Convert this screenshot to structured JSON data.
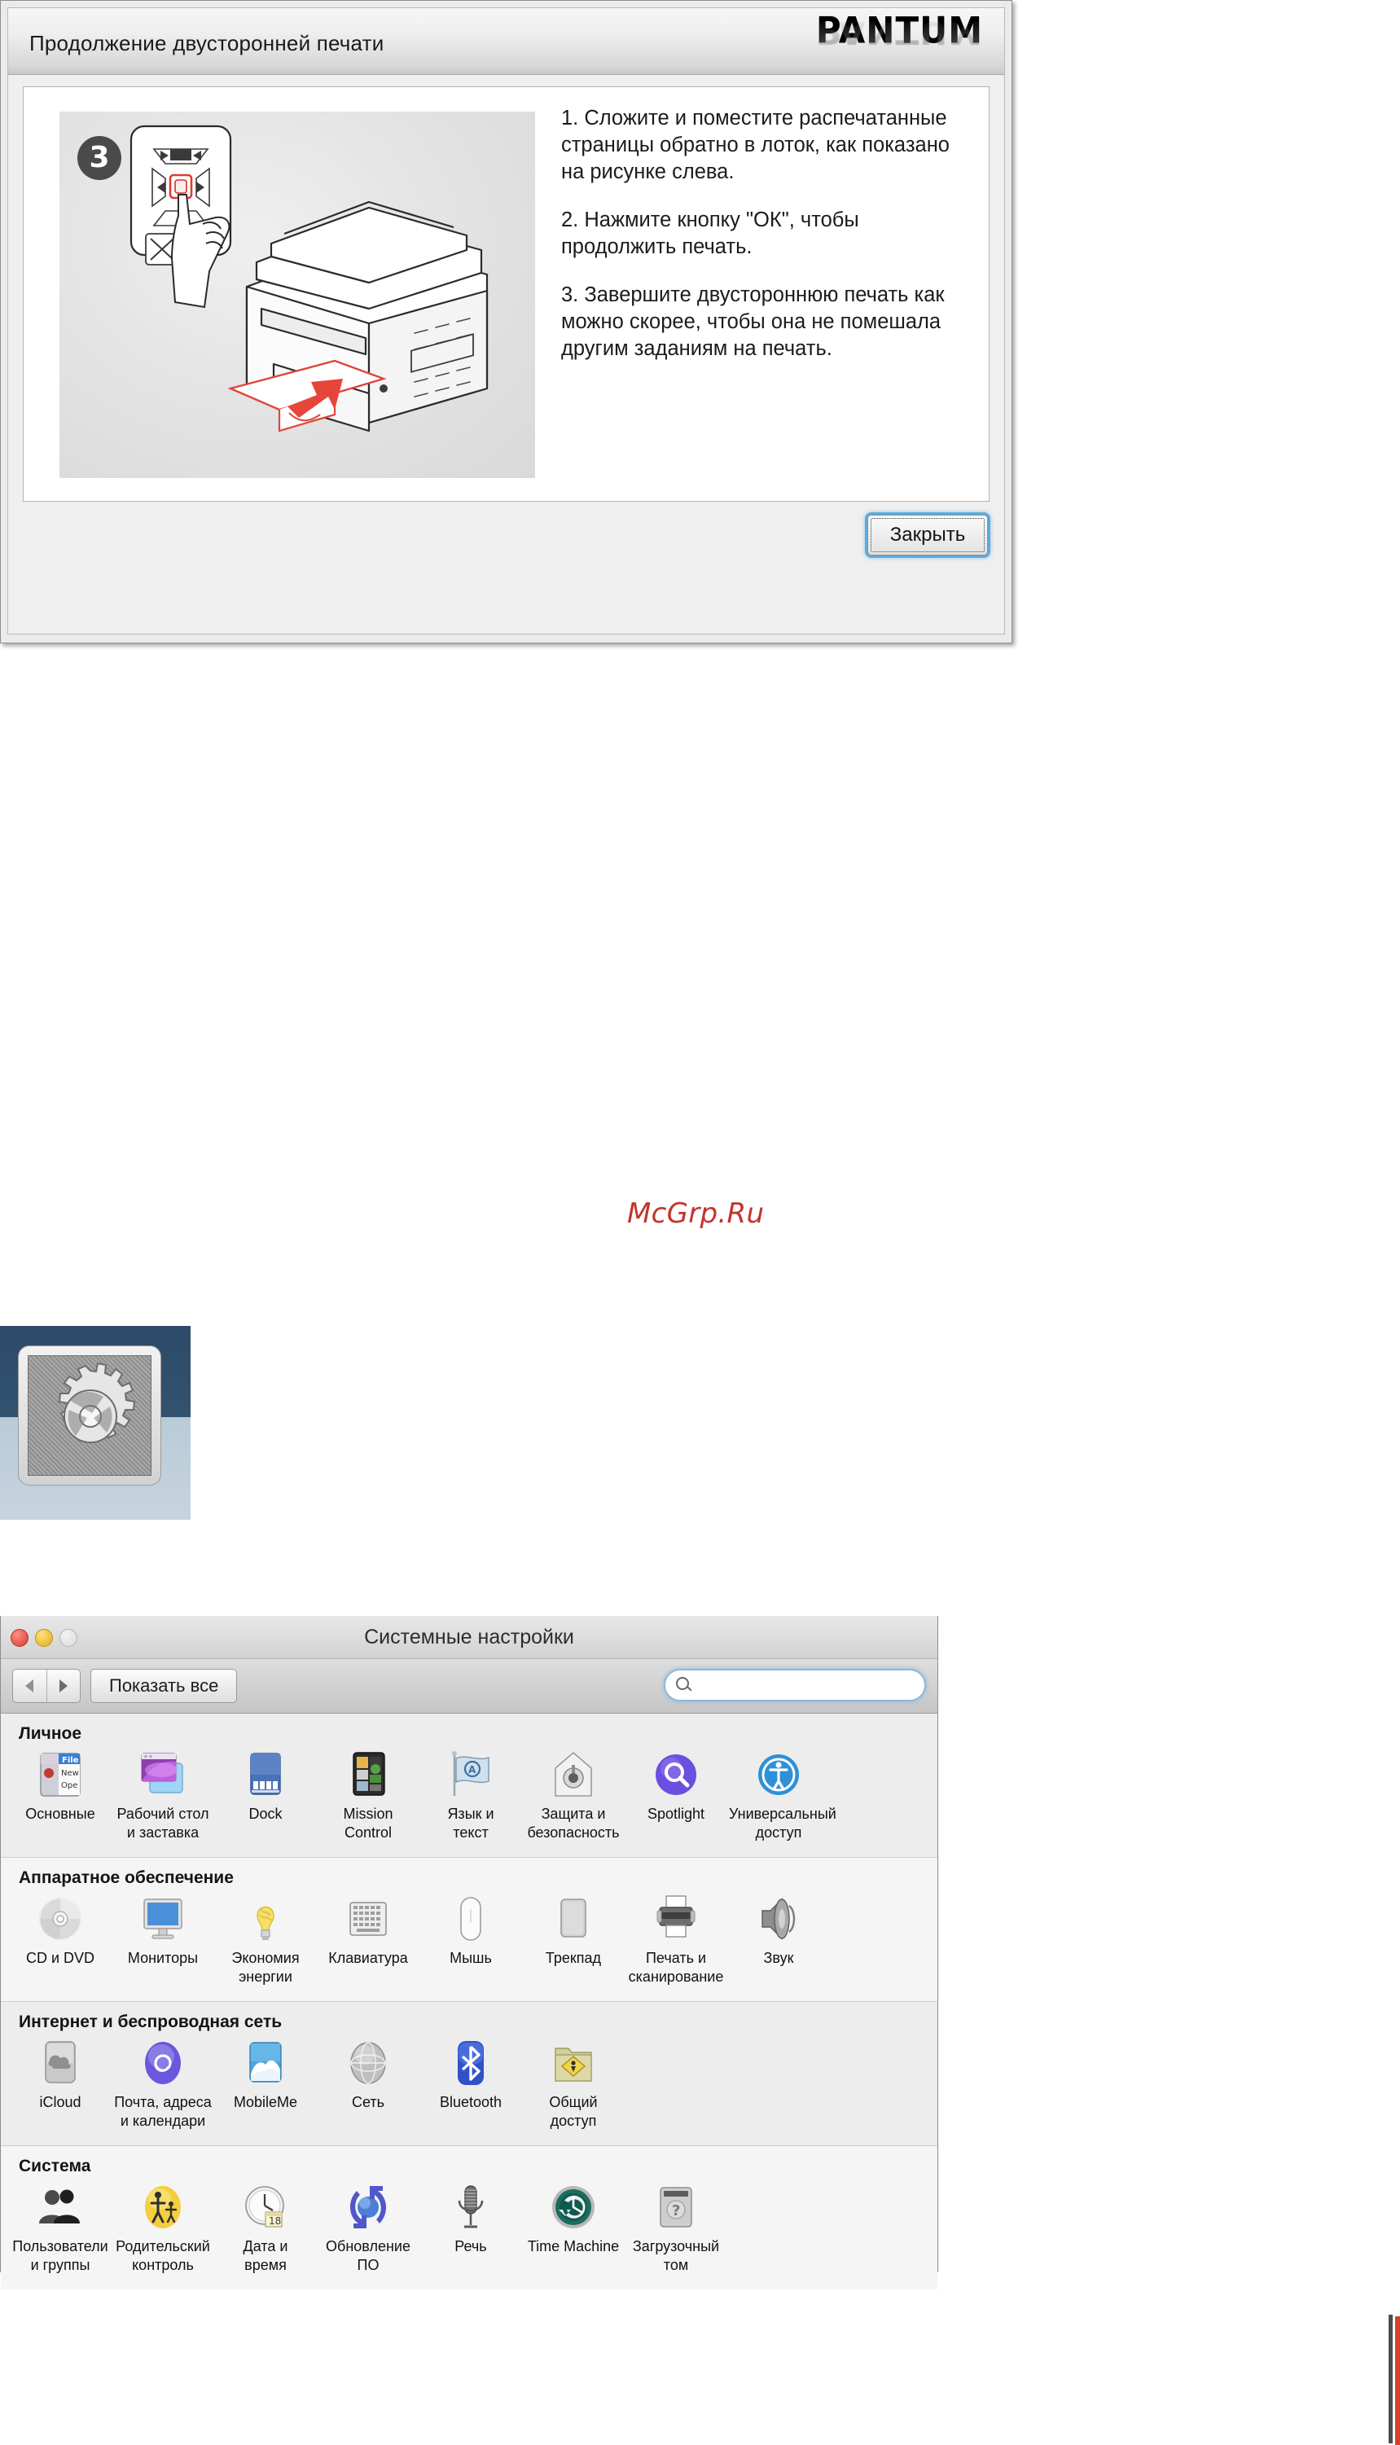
{
  "pantum_dialog": {
    "title": "Продолжение двусторонней печати",
    "brand_logo": "PANTUM",
    "step_number": "3",
    "instructions": [
      "1. Сложите и поместите распечатанные страницы обратно в лоток, как показано на рисунке слева.",
      "2. Нажмите кнопку \"ОК\", чтобы продолжить печать.",
      "3. Завершите двустороннюю печать как можно скорее, чтобы она не помешала другим заданиям на печать."
    ],
    "close_button": "Закрыть"
  },
  "watermark": {
    "text": "McGrp.Ru",
    "color": "#c1352c"
  },
  "app_icon": {
    "name": "System Preferences",
    "icon": "gears-icon"
  },
  "system_preferences": {
    "window_title": "Системные настройки",
    "toolbar": {
      "back_icon": "chevron-left-icon",
      "forward_icon": "chevron-right-icon",
      "show_all_label": "Показать все",
      "search_placeholder": "",
      "search_value": "",
      "search_icon": "search-icon"
    },
    "sections": [
      {
        "title": "Личное",
        "items": [
          {
            "label": "Основные",
            "icon": "general-icon"
          },
          {
            "label": "Рабочий стол\nи заставка",
            "icon": "desktop-screensaver-icon"
          },
          {
            "label": "Dock",
            "icon": "dock-icon"
          },
          {
            "label": "Mission\nControl",
            "icon": "mission-control-icon"
          },
          {
            "label": "Язык и\nтекст",
            "icon": "language-text-icon"
          },
          {
            "label": "Защита и\nбезопасность",
            "icon": "security-privacy-icon"
          },
          {
            "label": "Spotlight",
            "icon": "spotlight-icon"
          },
          {
            "label": "Универсальный\nдоступ",
            "icon": "universal-access-icon"
          }
        ]
      },
      {
        "title": "Аппаратное обеспечение",
        "items": [
          {
            "label": "CD и DVD",
            "icon": "cd-dvd-icon"
          },
          {
            "label": "Мониторы",
            "icon": "displays-icon"
          },
          {
            "label": "Экономия\nэнергии",
            "icon": "energy-saver-icon"
          },
          {
            "label": "Клавиатура",
            "icon": "keyboard-icon"
          },
          {
            "label": "Мышь",
            "icon": "mouse-icon"
          },
          {
            "label": "Трекпад",
            "icon": "trackpad-icon"
          },
          {
            "label": "Печать и\nсканирование",
            "icon": "print-scan-icon"
          },
          {
            "label": "Звук",
            "icon": "sound-icon"
          }
        ]
      },
      {
        "title": "Интернет и беспроводная сеть",
        "items": [
          {
            "label": "iCloud",
            "icon": "icloud-icon"
          },
          {
            "label": "Почта, адреса\nи календари",
            "icon": "mail-contacts-calendars-icon"
          },
          {
            "label": "MobileMe",
            "icon": "mobileme-icon"
          },
          {
            "label": "Сеть",
            "icon": "network-icon"
          },
          {
            "label": "Bluetooth",
            "icon": "bluetooth-icon"
          },
          {
            "label": "Общий\nдоступ",
            "icon": "sharing-icon"
          }
        ]
      },
      {
        "title": "Система",
        "items": [
          {
            "label": "Пользователи\nи группы",
            "icon": "users-groups-icon"
          },
          {
            "label": "Родительский\nконтроль",
            "icon": "parental-controls-icon"
          },
          {
            "label": "Дата и\nвремя",
            "icon": "date-time-icon"
          },
          {
            "label": "Обновление\nПО",
            "icon": "software-update-icon"
          },
          {
            "label": "Речь",
            "icon": "speech-icon"
          },
          {
            "label": "Time Machine",
            "icon": "time-machine-icon"
          },
          {
            "label": "Загрузочный\nтом",
            "icon": "startup-disk-icon"
          }
        ]
      }
    ]
  }
}
